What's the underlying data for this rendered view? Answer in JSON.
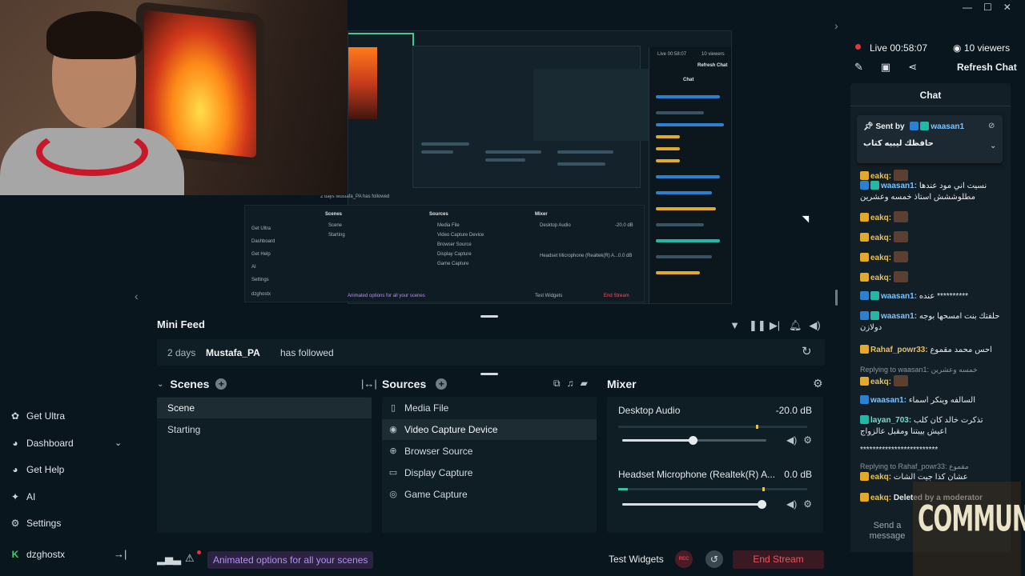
{
  "preview": {
    "inner_feed": "2 days   Mustafa_PA  has followed",
    "inner_scenes_label": "Scenes",
    "inner_sources_label": "Sources",
    "inner_mixer_label": "Mixer",
    "inner_scene_1": "Scene",
    "inner_scene_2": "Starting",
    "inner_source_1": "Media File",
    "inner_source_2": "Video Capture Device",
    "inner_source_3": "Browser Source",
    "inner_source_4": "Display Capture",
    "inner_source_5": "Game Capture",
    "inner_mixer_1": "Desktop Audio",
    "inner_mixer_1_db": "-20.0 dB",
    "inner_mixer_2": "Headset Microphone (Realtek(R) A...",
    "inner_mixer_2_db": "0.0 dB",
    "inner_side": [
      "Get Ultra",
      "Dashboard",
      "Get Help",
      "AI",
      "Settings",
      "dzghostx"
    ],
    "inner_badge": "Animated options for all your scenes",
    "inner_test": "Test Widgets",
    "inner_end": "End Stream",
    "inner_chat": "Chat",
    "inner_live": "Live 00:58:07",
    "inner_viewers": "10 viewers",
    "inner_refresh": "Refresh Chat"
  },
  "minifeed": {
    "title": "Mini Feed",
    "time": "2 days",
    "user": "Mustafa_PA",
    "action": "has followed"
  },
  "scenes": {
    "title": "Scenes",
    "items": [
      "Scene",
      "Starting"
    ]
  },
  "sources": {
    "title": "Sources",
    "items": [
      "Media File",
      "Video Capture Device",
      "Browser Source",
      "Display Capture",
      "Game Capture"
    ]
  },
  "mixer": {
    "title": "Mixer",
    "channels": [
      {
        "name": "Desktop Audio",
        "db": "-20.0 dB",
        "volume": 0.49
      },
      {
        "name": "Headset Microphone (Realtek(R) A...",
        "db": "0.0 dB",
        "volume": 1.0
      }
    ]
  },
  "sidebar": {
    "items": [
      "Get Ultra",
      "Dashboard",
      "Get Help",
      "AI",
      "Settings"
    ],
    "user": "dzghostx"
  },
  "footer": {
    "badge": "Animated options for all your scenes",
    "test_widgets": "Test Widgets",
    "rec": "REC",
    "end_stream": "End Stream"
  },
  "stream": {
    "live": "Live 00:58:07",
    "viewers": "10 viewers",
    "refresh_chat": "Refresh Chat"
  },
  "chat": {
    "title": "Chat",
    "pinned": {
      "label": "Sent by",
      "user": "waasan1",
      "text": "حافظك ليبيه كتاب"
    },
    "messages": [
      {
        "user": "eakq:",
        "color": "gold",
        "text": ""
      },
      {
        "user": "waasan1:",
        "color": "blue",
        "text": "نسيت اني مود عندها مطلوششش استاذ خمسه وعشرين"
      },
      {
        "user": "eakq:",
        "color": "gold",
        "text": ""
      },
      {
        "user": "eakq:",
        "color": "gold",
        "text": ""
      },
      {
        "user": "eakq:",
        "color": "gold",
        "text": ""
      },
      {
        "user": "eakq:",
        "color": "gold",
        "text": ""
      },
      {
        "user": "waasan1:",
        "color": "blue",
        "text": "عنده **********"
      },
      {
        "user": "waasan1:",
        "color": "blue",
        "text": "حلفتك بنت امسحها بوجه دولازن"
      },
      {
        "user": "Rahaf_powr33:",
        "color": "gold",
        "text": "احس محمد مقموع"
      },
      {
        "reply": "Replying to waasan1: خمسه وعشرين",
        "user": "eakq:",
        "color": "gold",
        "text": ""
      },
      {
        "user": "waasan1:",
        "color": "blue",
        "text": "السالفه وينكر اسماء"
      },
      {
        "user": "layan_703:",
        "color": "teal",
        "text": "تذكرت خالد كان كلب اعيش بيبتنا ومقبل عالزواج"
      },
      {
        "user": "",
        "color": "gold",
        "text": "*************************"
      },
      {
        "reply": "Replying to Rahaf_powr33: مقموع",
        "user": "eakq:",
        "color": "gold",
        "text": "عشان كذا جيت الشات"
      },
      {
        "user": "eakq:",
        "color": "gold",
        "text": "Deleted by a moderator"
      }
    ],
    "send_placeholder": "Send a message"
  },
  "overlay": {
    "community": "COMMUNITY"
  }
}
